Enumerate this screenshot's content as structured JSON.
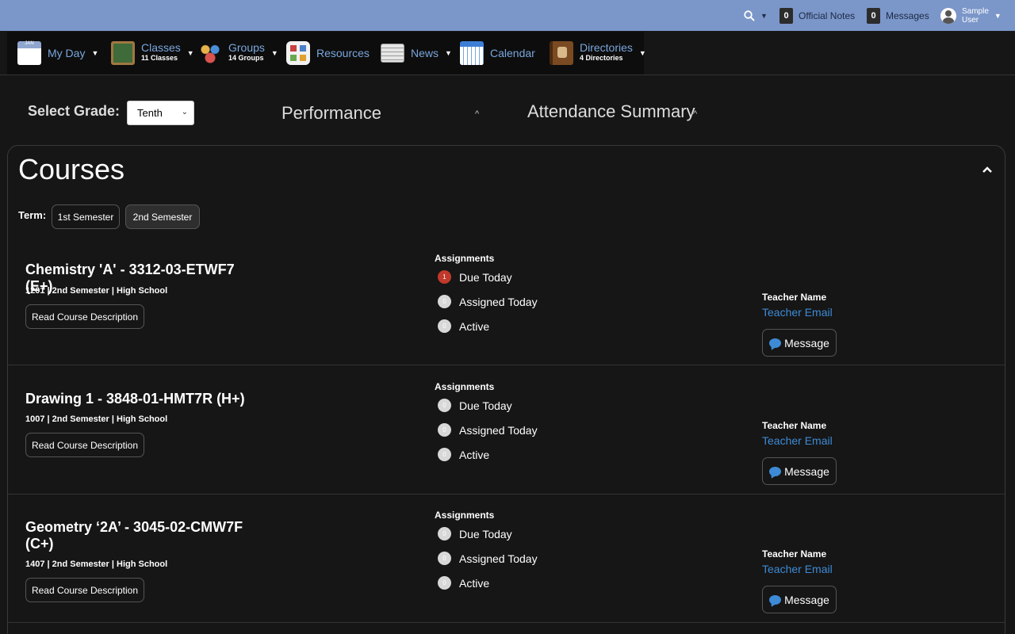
{
  "topbar": {
    "official_notes_count": "0",
    "official_notes_label": "Official Notes",
    "messages_count": "0",
    "messages_label": "Messages",
    "user_first": "Sample",
    "user_last": "User"
  },
  "nav": {
    "myday": {
      "label": "My Day",
      "icon_text": "JAN"
    },
    "classes": {
      "label": "Classes",
      "sub": "11 Classes"
    },
    "groups": {
      "label": "Groups",
      "sub": "14 Groups"
    },
    "resources": {
      "label": "Resources"
    },
    "news": {
      "label": "News"
    },
    "calendar": {
      "label": "Calendar"
    },
    "directories": {
      "label": "Directories",
      "sub": "4 Directories"
    }
  },
  "filters": {
    "grade_label": "Select Grade:",
    "grade_value": "Tenth",
    "performance_label": "Performance",
    "attendance_label": "Attendance Summary"
  },
  "courses_panel": {
    "title": "Courses",
    "term_label": "Term:",
    "terms": [
      "1st Semester",
      "2nd Semester"
    ],
    "active_term": "2nd Semester",
    "assignments_title": "Assignments",
    "teacher_name": "Teacher Name",
    "teacher_email": "Teacher Email",
    "read_desc_label": "Read Course Description",
    "message_label": "Message",
    "courses": [
      {
        "name": "Chemistry 'A' - 3312-03-ETWF7 (E+)",
        "meta": "1201 | 2nd Semester | High School",
        "due_today": {
          "label": "Due Today",
          "count": "1"
        },
        "assigned_today": {
          "label": "Assigned Today",
          "count": "0"
        },
        "active": {
          "label": "Active",
          "count": "0"
        }
      },
      {
        "name": "Drawing 1 - 3848-01-HMT7R (H+)",
        "meta": "1007 | 2nd Semester | High School",
        "due_today": {
          "label": "Due Today",
          "count": "0"
        },
        "assigned_today": {
          "label": "Assigned Today",
          "count": "0"
        },
        "active": {
          "label": "Active",
          "count": "0"
        }
      },
      {
        "name": "Geometry ‘2A’ - 3045-02-CMW7F (C+)",
        "meta": "1407 | 2nd Semester | High School",
        "due_today": {
          "label": "Due Today",
          "count": "0"
        },
        "assigned_today": {
          "label": "Assigned Today",
          "count": "0"
        },
        "active": {
          "label": "Active",
          "count": "0"
        }
      }
    ]
  },
  "colors": {
    "topbar": "#7b96c9",
    "nav_link": "#7aa6dc",
    "link": "#3d8bd6",
    "alert": "#c0392b"
  }
}
